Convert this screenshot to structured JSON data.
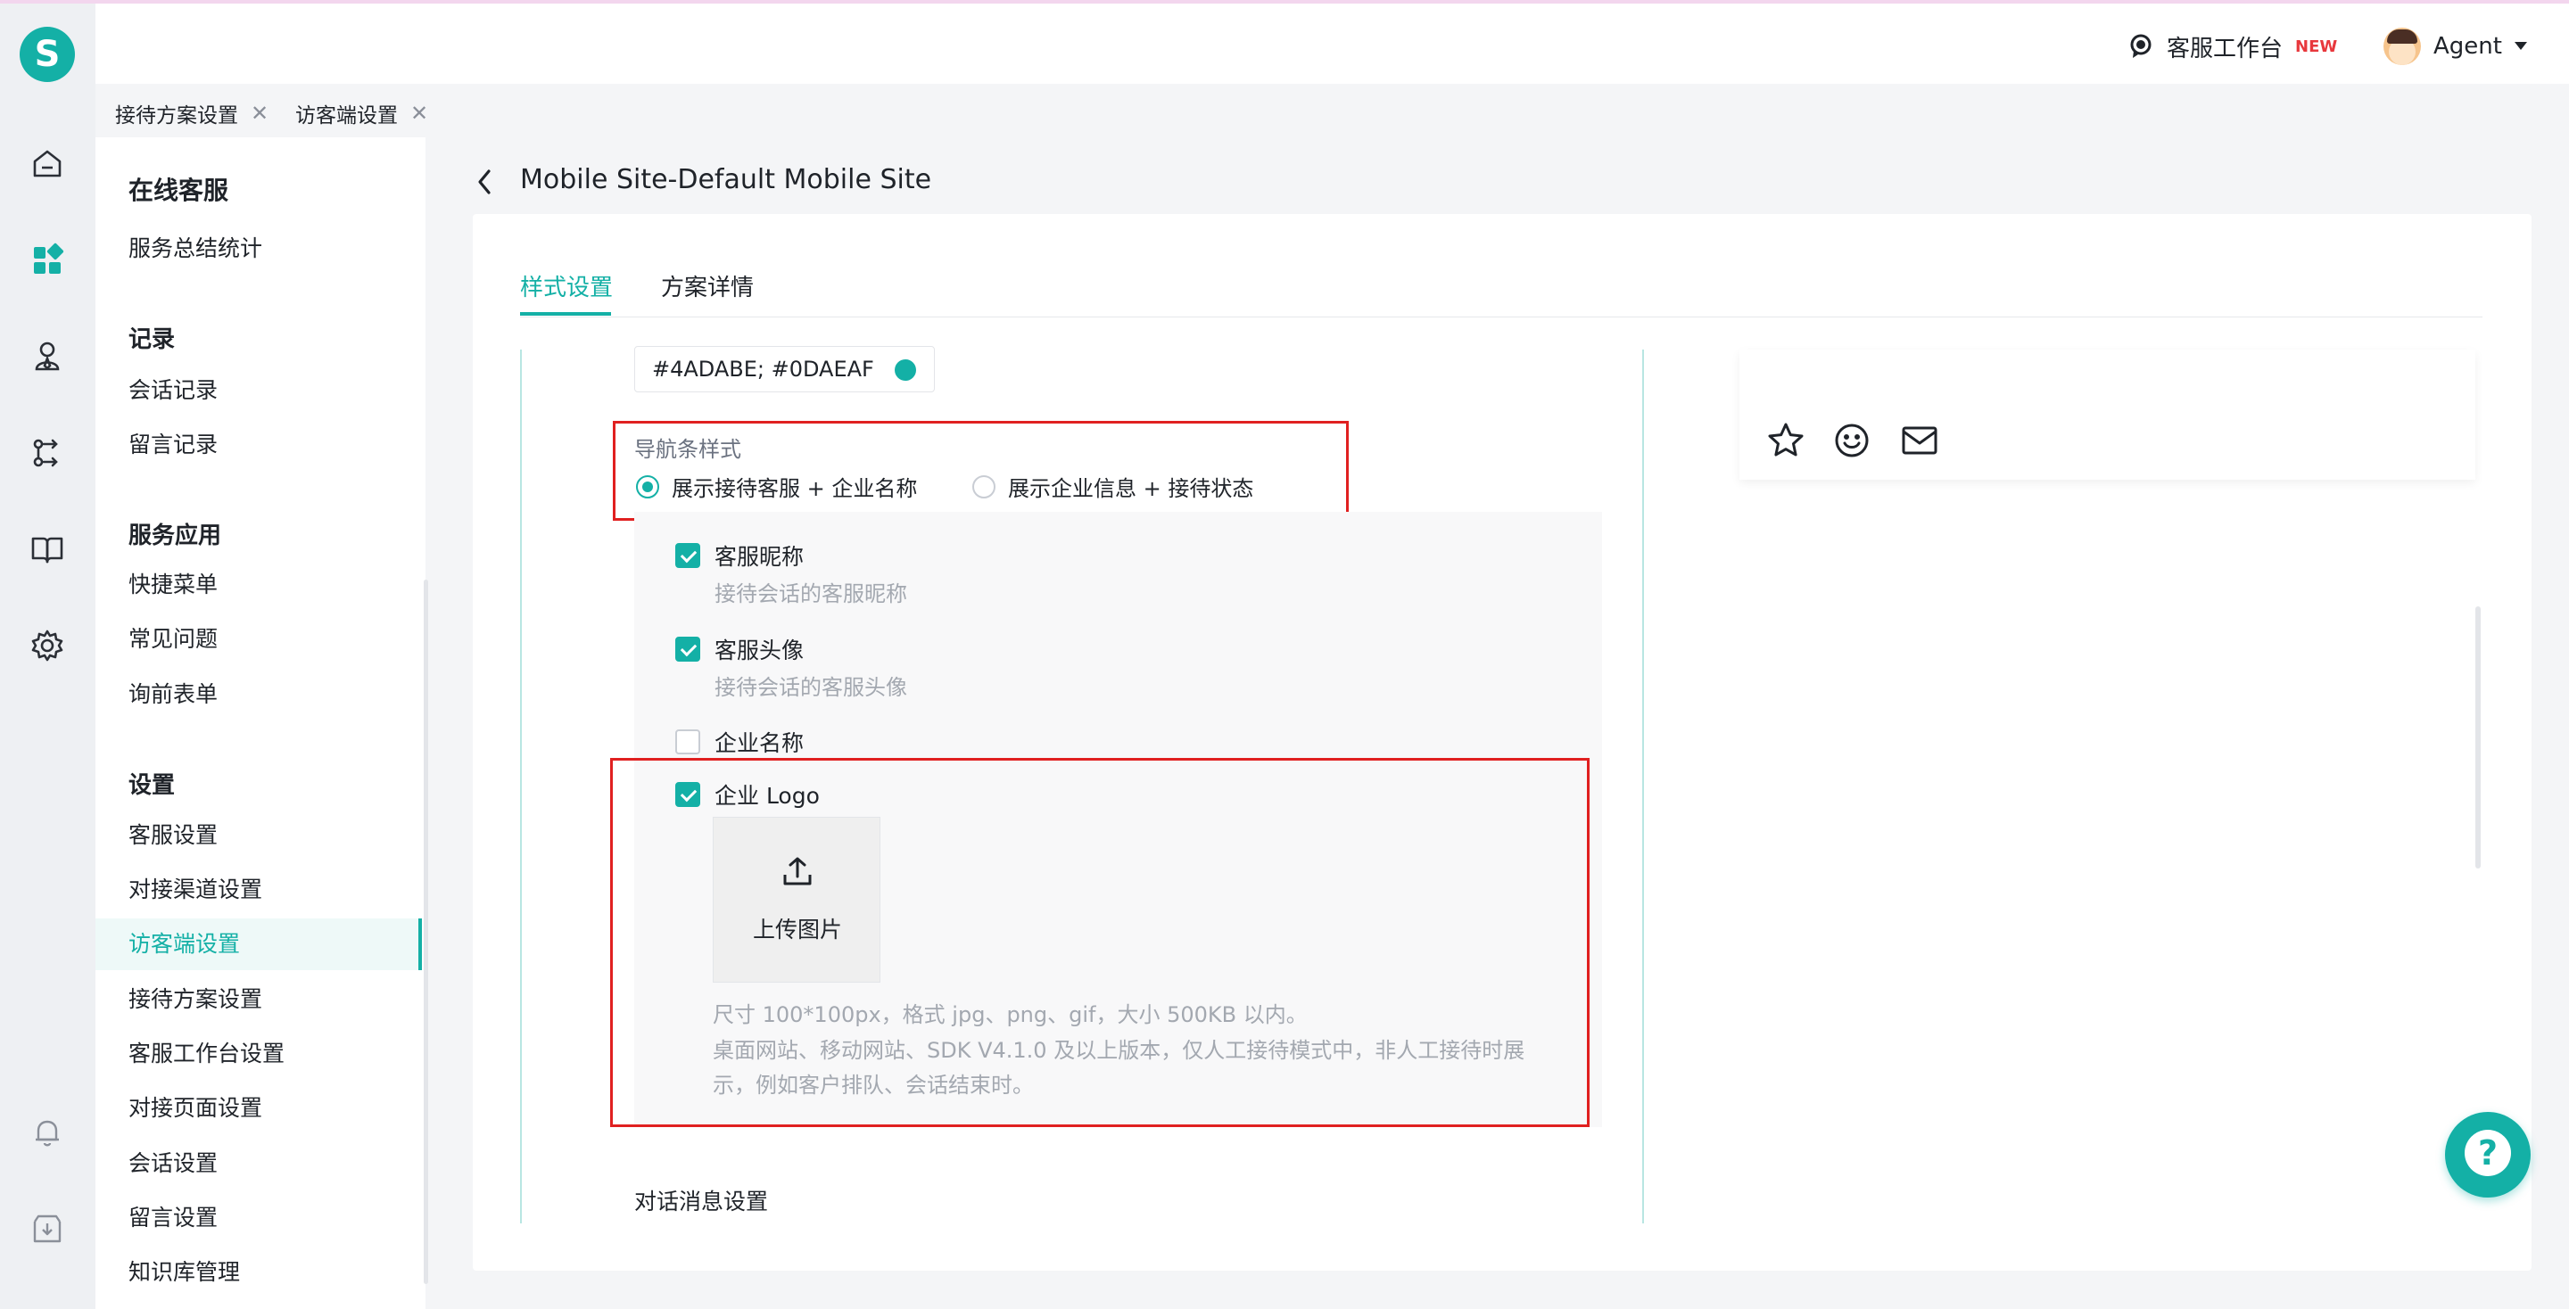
{
  "brand": {
    "logo_letter": "S",
    "accent": "#14B0A6"
  },
  "topbar": {
    "workbench_label": "客服工作台",
    "new_badge": "NEW",
    "agent_name": "Agent"
  },
  "tabs": [
    {
      "label": "接待方案设置",
      "close": "✕"
    },
    {
      "label": "访客端设置",
      "close": "✕"
    }
  ],
  "rail_icons": [
    "home-icon",
    "apps-icon",
    "customer-icon",
    "route-icon",
    "book-icon",
    "settings-icon",
    "bell-icon",
    "download-icon"
  ],
  "menu": {
    "title": "在线客服",
    "summary": "服务总结统计",
    "groups": [
      {
        "title": "记录",
        "items": [
          "会话记录",
          "留言记录"
        ]
      },
      {
        "title": "服务应用",
        "items": [
          "快捷菜单",
          "常见问题",
          "询前表单"
        ]
      },
      {
        "title": "设置",
        "items": [
          "客服设置",
          "对接渠道设置",
          "访客端设置",
          "接待方案设置",
          "客服工作台设置",
          "对接页面设置",
          "会话设置",
          "留言设置",
          "知识库管理"
        ]
      }
    ],
    "active_item": "访客端设置"
  },
  "page": {
    "title": "Mobile Site-Default Mobile Site",
    "subtabs": [
      "样式设置",
      "方案详情"
    ],
    "active_subtab": "样式设置"
  },
  "form": {
    "color_value": "#4ADABE; #0DAEAF",
    "color_swatch": "#14B0A6",
    "nav_style_label": "导航条样式",
    "nav_options": [
      "展示接待客服 + 企业名称",
      "展示企业信息 + 接待状态"
    ],
    "nav_selected": "展示接待客服 + 企业名称",
    "checkboxes": [
      {
        "label": "客服昵称",
        "desc": "接待会话的客服昵称",
        "checked": true
      },
      {
        "label": "客服头像",
        "desc": "接待会话的客服头像",
        "checked": true
      },
      {
        "label": "企业名称",
        "desc": "",
        "checked": false
      },
      {
        "label": "企业 Logo",
        "desc": "",
        "checked": true
      }
    ],
    "upload_label": "上传图片",
    "hint_lines": [
      "尺寸 100*100px，格式 jpg、png、gif，大小 500KB 以内。",
      "桌面网站、移动网站、SDK V4.1.0 及以上版本，仅人工接待模式中，非人工接待时展",
      "示，例如客户排队、会话结束时。"
    ],
    "message_settings_title": "对话消息设置"
  },
  "preview": {
    "icons": [
      "star-icon",
      "smile-icon",
      "mail-icon"
    ]
  },
  "help": {
    "glyph": "?"
  }
}
